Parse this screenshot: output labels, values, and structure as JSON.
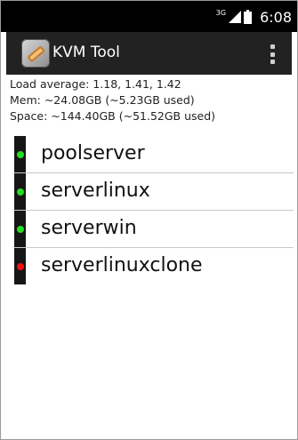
{
  "status_bar": {
    "network_label": "3G",
    "time": "6:08",
    "icons": [
      "signal-icon",
      "battery-icon"
    ]
  },
  "app": {
    "title": "KVM Tool",
    "icon": "kvm-app-icon",
    "menu_icon": "overflow-menu-icon"
  },
  "stats": {
    "load": "Load average: 1.18, 1.41, 1.42",
    "mem": "Mem: ~24.08GB (~5.23GB used)",
    "space": "Space: ~144.40GB (~51.52GB used)"
  },
  "servers": [
    {
      "name": "poolserver",
      "status_color": "#22dd22"
    },
    {
      "name": "serverlinux",
      "status_color": "#22dd22"
    },
    {
      "name": "serverwin",
      "status_color": "#22dd22"
    },
    {
      "name": "serverlinuxclone",
      "status_color": "#ee1111"
    }
  ]
}
